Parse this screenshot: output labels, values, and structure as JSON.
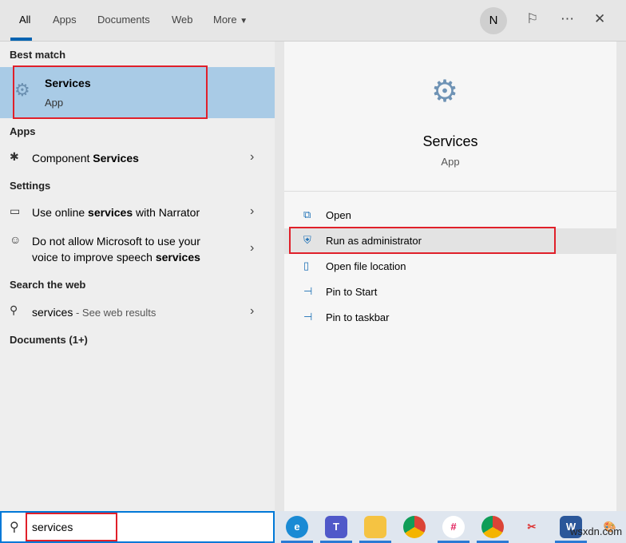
{
  "tabs": [
    "All",
    "Apps",
    "Documents",
    "Web",
    "More"
  ],
  "header": {
    "avatar": "N",
    "feedback_icon": "feedback-icon",
    "more_icon": "⋯",
    "close_icon": "✕"
  },
  "best_match": {
    "heading": "Best match",
    "title": "Services",
    "subtitle": "App"
  },
  "apps": {
    "heading": "Apps",
    "items": [
      {
        "pre": "Component ",
        "bold": "Services"
      }
    ]
  },
  "settings": {
    "heading": "Settings",
    "items": [
      {
        "pre": "Use online ",
        "bold": "services",
        "post": " with Narrator"
      },
      {
        "line1": "Do not allow Microsoft to use your",
        "pre": "voice to improve speech ",
        "bold": "services"
      }
    ]
  },
  "web": {
    "heading": "Search the web",
    "query": "services",
    "suffix": " - See web results"
  },
  "documents": {
    "heading": "Documents (1+)"
  },
  "preview": {
    "title": "Services",
    "subtitle": "App",
    "actions": [
      "Open",
      "Run as administrator",
      "Open file location",
      "Pin to Start",
      "Pin to taskbar"
    ]
  },
  "search": {
    "value": "services"
  },
  "taskbar": [
    "edge",
    "teams",
    "file-explorer",
    "chrome",
    "slack",
    "chrome-profile",
    "snip-sketch",
    "word",
    "paint"
  ],
  "watermark": "wsxdn.com",
  "colors": {
    "accent": "#0078d7",
    "highlight": "#a9cbe6",
    "annotation": "#e0202a"
  }
}
